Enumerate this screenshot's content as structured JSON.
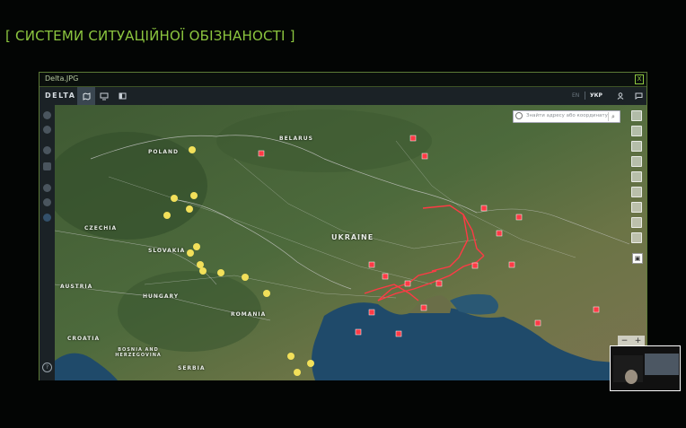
{
  "slide": {
    "title": "[ СИСТЕМИ СИТУАЦІЙНОЇ ОБІЗНАНОСТІ ]"
  },
  "window": {
    "title": "Delta.JPG",
    "close_label": "X"
  },
  "app": {
    "brand": "DELTA",
    "toolbar": [
      {
        "icon": "map-icon",
        "active": true
      },
      {
        "icon": "layers-icon",
        "active": false
      },
      {
        "icon": "panel-icon",
        "active": false
      }
    ],
    "lang_en": "EN",
    "lang_ukr": "УКР",
    "user_icon": "user-icon",
    "chat_icon": "chat-icon"
  },
  "map": {
    "search_placeholder": "Знайти адресу або координату",
    "zoom_out": "−",
    "zoom_in": "+",
    "countries": {
      "poland": "POLAND",
      "belarus": "BELARUS",
      "czechia": "CZECHIA",
      "slovakia": "SLOVAKIA",
      "ukraine": "UKRAINE",
      "austria": "AUSTRIA",
      "hungary": "HUNGARY",
      "romania": "ROMANIA",
      "croatia": "CROATIA",
      "bosnia": "BOSNIA AND HERZEGOVINA",
      "serbia": "SERBIA"
    },
    "colors": {
      "hostile": "#e8404a",
      "friendly": "#f2e05a",
      "accent": "#8cc63f"
    }
  }
}
